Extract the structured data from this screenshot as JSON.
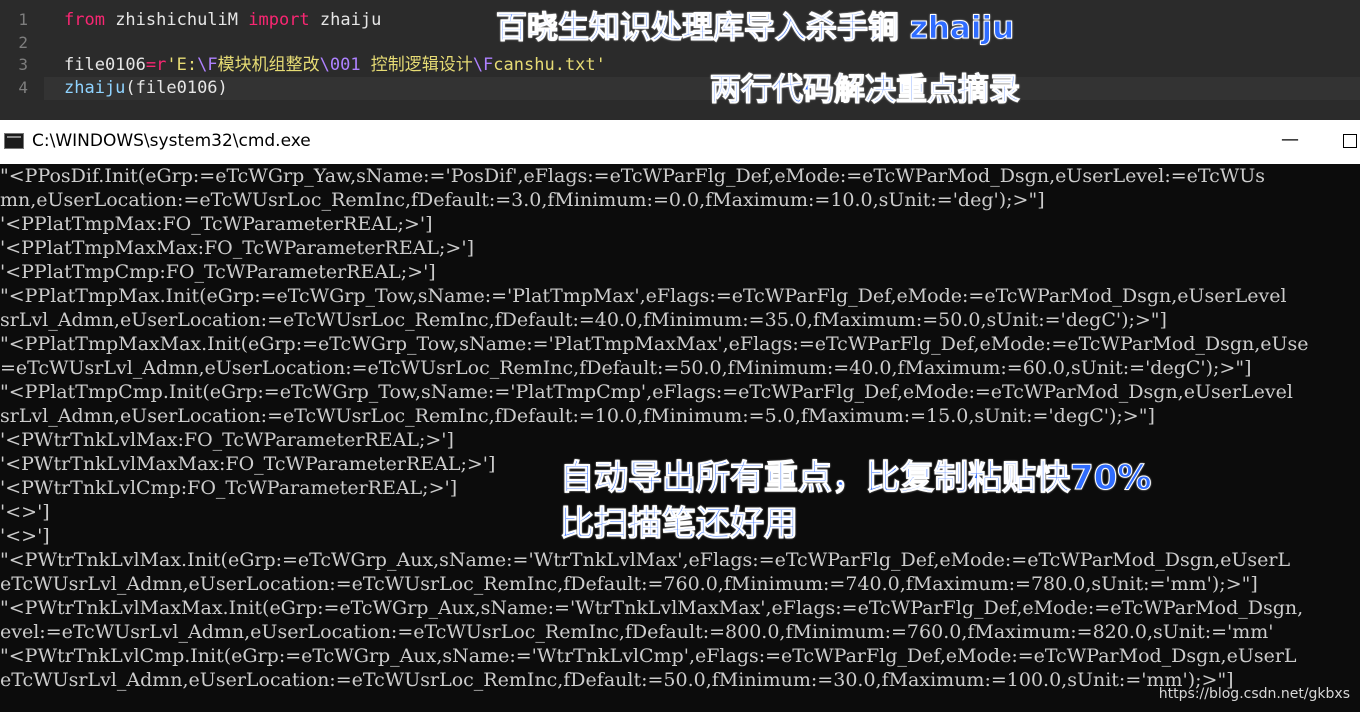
{
  "editor": {
    "line_numbers": [
      "1",
      "2",
      "3",
      "4"
    ],
    "line1": {
      "kw_from": "from",
      "module": " zhishichuliM ",
      "kw_import": "import",
      "name": " zhaiju"
    },
    "line3": {
      "var": "file0106",
      "op": "=",
      "prefix": "r",
      "q1": "'",
      "p1": "E:",
      "e1": "\\F",
      "p2": "模块机组整改",
      "e2": "\\001",
      "p3": " 控制逻辑设计",
      "e3": "\\F",
      "p4": "canshu.txt",
      "q2": "'"
    },
    "line4": {
      "fn": "zhaiju",
      "args": "(file0106)"
    }
  },
  "overlays": {
    "title_top": "百晓生知识处理库导入杀手锏 zhaiju",
    "subtitle_top": "两行代码解决重点摘录",
    "promo_line1": "自动导出所有重点，比复制粘贴快70%",
    "promo_line2": "比扫描笔还好用"
  },
  "cmd": {
    "title": "C:\\WINDOWS\\system32\\cmd.exe",
    "minimize_glyph": "—",
    "lines": [
      "\"<PPosDif.Init(eGrp:=eTcWGrp_Yaw,sName:='PosDif',eFlags:=eTcWParFlg_Def,eMode:=eTcWParMod_Dsgn,eUserLevel:=eTcWUs",
      "mn,eUserLocation:=eTcWUsrLoc_RemInc,fDefault:=3.0,fMinimum:=0.0,fMaximum:=10.0,sUnit:='deg');>\"]",
      "'<PPlatTmpMax:FO_TcWParameterREAL;>']",
      "'<PPlatTmpMaxMax:FO_TcWParameterREAL;>']",
      "'<PPlatTmpCmp:FO_TcWParameterREAL;>']",
      "\"<PPlatTmpMax.Init(eGrp:=eTcWGrp_Tow,sName:='PlatTmpMax',eFlags:=eTcWParFlg_Def,eMode:=eTcWParMod_Dsgn,eUserLevel",
      "srLvl_Admn,eUserLocation:=eTcWUsrLoc_RemInc,fDefault:=40.0,fMinimum:=35.0,fMaximum:=50.0,sUnit:='degC');>\"]",
      "\"<PPlatTmpMaxMax.Init(eGrp:=eTcWGrp_Tow,sName:='PlatTmpMaxMax',eFlags:=eTcWParFlg_Def,eMode:=eTcWParMod_Dsgn,eUse",
      "=eTcWUsrLvl_Admn,eUserLocation:=eTcWUsrLoc_RemInc,fDefault:=50.0,fMinimum:=40.0,fMaximum:=60.0,sUnit:='degC');>\"]",
      "\"<PPlatTmpCmp.Init(eGrp:=eTcWGrp_Tow,sName:='PlatTmpCmp',eFlags:=eTcWParFlg_Def,eMode:=eTcWParMod_Dsgn,eUserLevel",
      "srLvl_Admn,eUserLocation:=eTcWUsrLoc_RemInc,fDefault:=10.0,fMinimum:=5.0,fMaximum:=15.0,sUnit:='degC');>\"]",
      "'<PWtrTnkLvlMax:FO_TcWParameterREAL;>']",
      "'<PWtrTnkLvlMaxMax:FO_TcWParameterREAL;>']",
      "'<PWtrTnkLvlCmp:FO_TcWParameterREAL;>']",
      "'<>']",
      "'<>']",
      "\"<PWtrTnkLvlMax.Init(eGrp:=eTcWGrp_Aux,sName:='WtrTnkLvlMax',eFlags:=eTcWParFlg_Def,eMode:=eTcWParMod_Dsgn,eUserL",
      "eTcWUsrLvl_Admn,eUserLocation:=eTcWUsrLoc_RemInc,fDefault:=760.0,fMinimum:=740.0,fMaximum:=780.0,sUnit:='mm');>\"]",
      "\"<PWtrTnkLvlMaxMax.Init(eGrp:=eTcWGrp_Aux,sName:='WtrTnkLvlMaxMax',eFlags:=eTcWParFlg_Def,eMode:=eTcWParMod_Dsgn,",
      "evel:=eTcWUsrLvl_Admn,eUserLocation:=eTcWUsrLoc_RemInc,fDefault:=800.0,fMinimum:=760.0,fMaximum:=820.0,sUnit:='mm'",
      "\"<PWtrTnkLvlCmp.Init(eGrp:=eTcWGrp_Aux,sName:='WtrTnkLvlCmp',eFlags:=eTcWParFlg_Def,eMode:=eTcWParMod_Dsgn,eUserL",
      "eTcWUsrLvl_Admn,eUserLocation:=eTcWUsrLoc_RemInc,fDefault:=50.0,fMinimum:=30.0,fMaximum:=100.0,sUnit:='mm');>\"]"
    ]
  },
  "watermark": "https://blog.csdn.net/gkbxs"
}
